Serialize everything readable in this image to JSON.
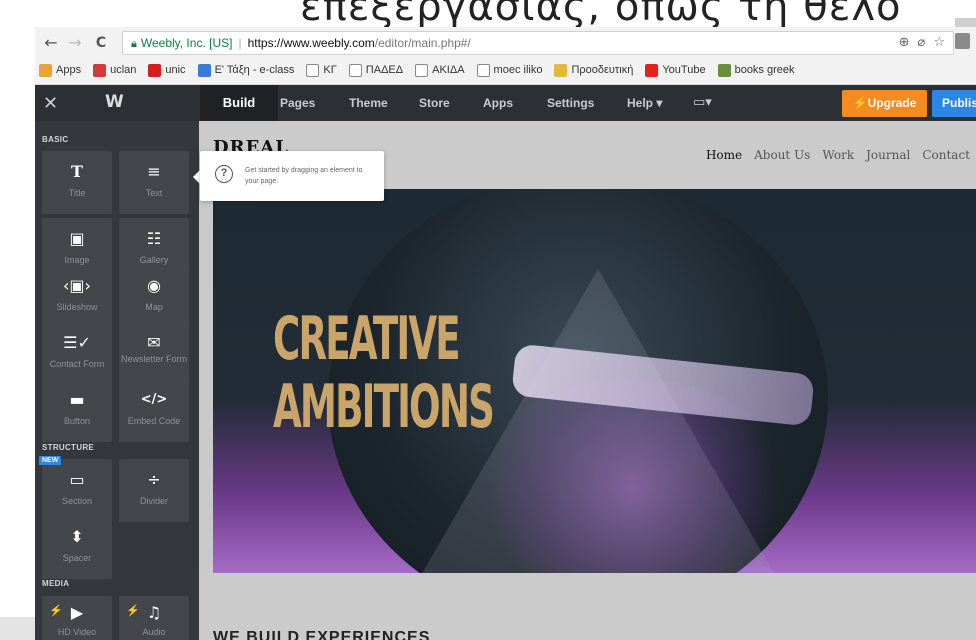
{
  "slide": {
    "title_fragment": "επεξεργασίας, όπως τη θέλο"
  },
  "browser": {
    "nav": {
      "back": "←",
      "forward": "→",
      "reload": "C"
    },
    "site_identity": "Weebly, Inc. [US]",
    "url_host": "https://www.weebly.com",
    "url_path": "/editor/main.php#/",
    "bookmarks": [
      {
        "label": "Apps",
        "icon": "apps-grid-icon",
        "color": "#e8a33a"
      },
      {
        "label": "uclan",
        "icon": "uclan-icon",
        "color": "#d23a3a"
      },
      {
        "label": "unic",
        "icon": "unic-icon",
        "color": "#d21f1f"
      },
      {
        "label": "Ε' Τάξη - e-class",
        "icon": "eclass-icon",
        "color": "#3a7bd5"
      },
      {
        "label": "ΚΓ",
        "icon": "page-icon",
        "color": "#ffffff"
      },
      {
        "label": "ΠΑΔΕΔ",
        "icon": "page-icon",
        "color": "#ffffff"
      },
      {
        "label": "ΑΚΙΔΑ",
        "icon": "page-icon",
        "color": "#ffffff"
      },
      {
        "label": "moec iliko",
        "icon": "page-icon",
        "color": "#ffffff"
      },
      {
        "label": "Προοδευτική",
        "icon": "proodeftiki-icon",
        "color": "#e2b93b"
      },
      {
        "label": "YouTube",
        "icon": "youtube-icon",
        "color": "#e62117"
      },
      {
        "label": "books greek",
        "icon": "books-icon",
        "color": "#6a8f3a"
      }
    ]
  },
  "editor": {
    "close": "✕",
    "logo": "W",
    "tabs": [
      "Build",
      "Pages",
      "Theme",
      "Store",
      "Apps",
      "Settings",
      "Help ▾"
    ],
    "device_icon": "▭▾",
    "upgrade_label": "⚡Upgrade",
    "publish_label": "Publish",
    "sections": {
      "basic": "BASIC",
      "structure": "STRUCTURE",
      "media": "MEDIA"
    },
    "new_badge": "NEW",
    "elements": {
      "title": "Title",
      "text": "Text",
      "image": "Image",
      "gallery": "Gallery",
      "slideshow": "Slideshow",
      "map": "Map",
      "contact_form": "Contact Form",
      "newsletter_form": "Newsletter Form",
      "button": "Button",
      "embed_code": "Embed Code",
      "section": "Section",
      "divider": "Divider",
      "spacer": "Spacer",
      "hd_video": "HD Video",
      "audio": "Audio"
    }
  },
  "tooltip": {
    "icon": "?",
    "text": "Get started by dragging an element to your page."
  },
  "site": {
    "brand": "DREAL",
    "nav": [
      "Home",
      "About Us",
      "Work",
      "Journal",
      "Contact"
    ],
    "hero_line1": "CREATIVE",
    "hero_line2": "AMBITIONS",
    "section_title": "WE BUILD EXPERIENCES"
  }
}
